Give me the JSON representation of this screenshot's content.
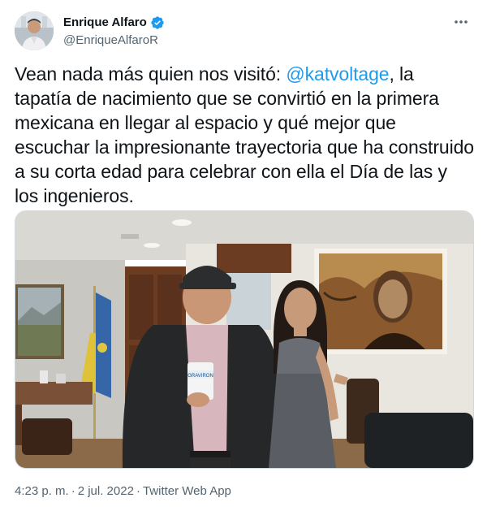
{
  "author": {
    "display_name": "Enrique Alfaro",
    "handle": "@EnriqueAlfaroR",
    "verified": true
  },
  "tweet": {
    "text_parts": {
      "before_mention": "Vean nada más quien nos visitó: ",
      "mention": "@katvoltage",
      "after_mention": ", la tapatía de nacimiento que se convirtió en la primera mexicana en llegar al espacio y qué mejor que escuchar la impresionante trayectoria que ha construido a su corta edad para celebrar con ella el Día de las y los ingenieros."
    }
  },
  "media": {
    "cup_label": "GRAVIRON"
  },
  "meta": {
    "time": "4:23 p. m.",
    "separator": "·",
    "date": "2 jul. 2022",
    "source": "Twitter Web App"
  },
  "icons": {
    "verified": "verified-badge-icon",
    "more": "more-dots-icon"
  },
  "colors": {
    "accent": "#1d9bf0",
    "text": "#0f1419",
    "secondary": "#536471"
  }
}
